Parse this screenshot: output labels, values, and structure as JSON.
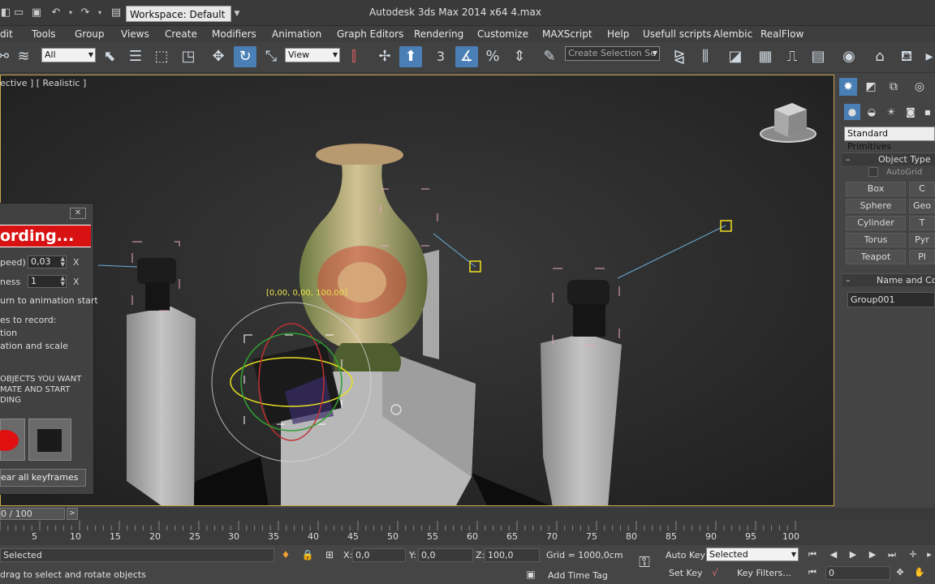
{
  "titlebar": {
    "workspace": "Workspace: Default",
    "app_title": "Autodesk 3ds Max  2014 x64      4.max"
  },
  "menu": [
    "dit",
    "Tools",
    "Group",
    "Views",
    "Create",
    "Modifiers",
    "Animation",
    "Graph Editors",
    "Rendering",
    "Customize",
    "MAXScript",
    "Help",
    "Usefull scripts",
    "Alembic",
    "RealFlow"
  ],
  "toolbar": {
    "selection_filter": "All",
    "ref_coord": "View",
    "snap_angle_label": "3",
    "named_selection_placeholder": "Create Selection Se"
  },
  "viewport": {
    "label": "ective ] [ Realistic ]",
    "gizmo_readout": "[0,00, 0,00, 100,00]",
    "colors": {
      "selection": "#e8a8c8",
      "light_target": "#f0e020",
      "frame": "#c8a84a"
    }
  },
  "dialog": {
    "recording": "ording...",
    "speed_label": "peed)",
    "speed_value": "0,03",
    "smooth_label": "ness",
    "smooth_value": "1",
    "return_label": "urn to animation start",
    "record_label": "es to record:",
    "position_label": "tion",
    "rotscale_label": "ation and scale",
    "instructions": [
      "OBJECTS YOU WANT",
      "MATE AND START",
      "DING"
    ],
    "clear_label": "ear all keyframes",
    "x_label": "X"
  },
  "command_panel": {
    "category": "Standard Primitives",
    "object_type_title": "Object Type",
    "autogrid": "AutoGrid",
    "buttons": [
      {
        "left": "Box",
        "right": "C"
      },
      {
        "left": "Sphere",
        "right": "Geo"
      },
      {
        "left": "Cylinder",
        "right": "T"
      },
      {
        "left": "Torus",
        "right": "Pyr"
      },
      {
        "left": "Teapot",
        "right": "Pl"
      }
    ],
    "name_color_title": "Name and Colo",
    "object_name": "Group001"
  },
  "timeline": {
    "frame": "0 / 100",
    "ticks": [
      "5",
      "10",
      "15",
      "20",
      "25",
      "30",
      "35",
      "40",
      "45",
      "50",
      "55",
      "60",
      "65",
      "70",
      "75",
      "80",
      "85",
      "90",
      "95",
      "100"
    ]
  },
  "status": {
    "selected_text": "Selected",
    "prompt": "drag to select and rotate objects",
    "x_label": "X:",
    "x_value": "0,0",
    "y_label": "Y:",
    "y_value": "0,0",
    "z_label": "Z:",
    "z_value": "100,0",
    "grid": "Grid = 1000,0cm",
    "auto_key": "Auto Key",
    "auto_key_mode": "Selected",
    "set_key": "Set Key",
    "key_filters": "Key Filters...",
    "add_time_tag": "Add Time Tag",
    "current_frame": "0"
  }
}
